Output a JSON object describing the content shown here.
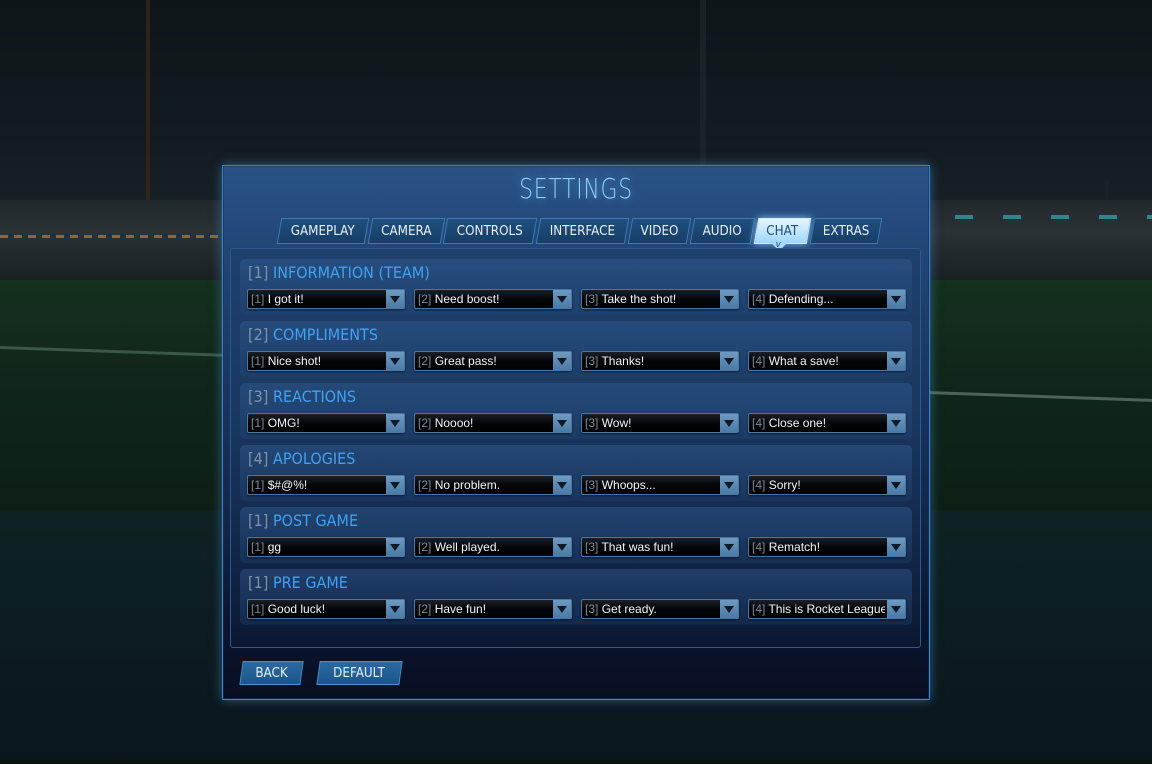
{
  "title": "SETTINGS",
  "tabs": [
    {
      "label": "GAMEPLAY",
      "active": false
    },
    {
      "label": "CAMERA",
      "active": false
    },
    {
      "label": "CONTROLS",
      "active": false
    },
    {
      "label": "INTERFACE",
      "active": false
    },
    {
      "label": "VIDEO",
      "active": false
    },
    {
      "label": "AUDIO",
      "active": false
    },
    {
      "label": "CHAT",
      "active": true
    },
    {
      "label": "EXTRAS",
      "active": false
    }
  ],
  "active_tab_indicator": "v",
  "groups": [
    {
      "key": "[1]",
      "name": "INFORMATION (TEAM)",
      "options": [
        {
          "key": "[1]",
          "value": "I got it!"
        },
        {
          "key": "[2]",
          "value": "Need boost!"
        },
        {
          "key": "[3]",
          "value": "Take the shot!"
        },
        {
          "key": "[4]",
          "value": "Defending..."
        }
      ]
    },
    {
      "key": "[2]",
      "name": "COMPLIMENTS",
      "options": [
        {
          "key": "[1]",
          "value": "Nice shot!"
        },
        {
          "key": "[2]",
          "value": "Great pass!"
        },
        {
          "key": "[3]",
          "value": "Thanks!"
        },
        {
          "key": "[4]",
          "value": "What a save!"
        }
      ]
    },
    {
      "key": "[3]",
      "name": "REACTIONS",
      "options": [
        {
          "key": "[1]",
          "value": "OMG!"
        },
        {
          "key": "[2]",
          "value": "Noooo!"
        },
        {
          "key": "[3]",
          "value": "Wow!"
        },
        {
          "key": "[4]",
          "value": "Close one!"
        }
      ]
    },
    {
      "key": "[4]",
      "name": "APOLOGIES",
      "options": [
        {
          "key": "[1]",
          "value": "$#@%!"
        },
        {
          "key": "[2]",
          "value": "No problem."
        },
        {
          "key": "[3]",
          "value": "Whoops..."
        },
        {
          "key": "[4]",
          "value": "Sorry!"
        }
      ]
    },
    {
      "key": "[1]",
      "name": "POST GAME",
      "options": [
        {
          "key": "[1]",
          "value": "gg"
        },
        {
          "key": "[2]",
          "value": "Well played."
        },
        {
          "key": "[3]",
          "value": "That was fun!"
        },
        {
          "key": "[4]",
          "value": "Rematch!"
        }
      ]
    },
    {
      "key": "[1]",
      "name": "PRE GAME",
      "options": [
        {
          "key": "[1]",
          "value": "Good luck!"
        },
        {
          "key": "[2]",
          "value": "Have fun!"
        },
        {
          "key": "[3]",
          "value": "Get ready."
        },
        {
          "key": "[4]",
          "value": "This is Rocket League!"
        }
      ]
    }
  ],
  "buttons": {
    "back": "BACK",
    "default": "DEFAULT"
  },
  "colors": {
    "accent": "#3fa2f2",
    "title_glow": "#8dd0ff",
    "active_tab": "#bfe6ff",
    "panel_border": "#3f86c8"
  }
}
